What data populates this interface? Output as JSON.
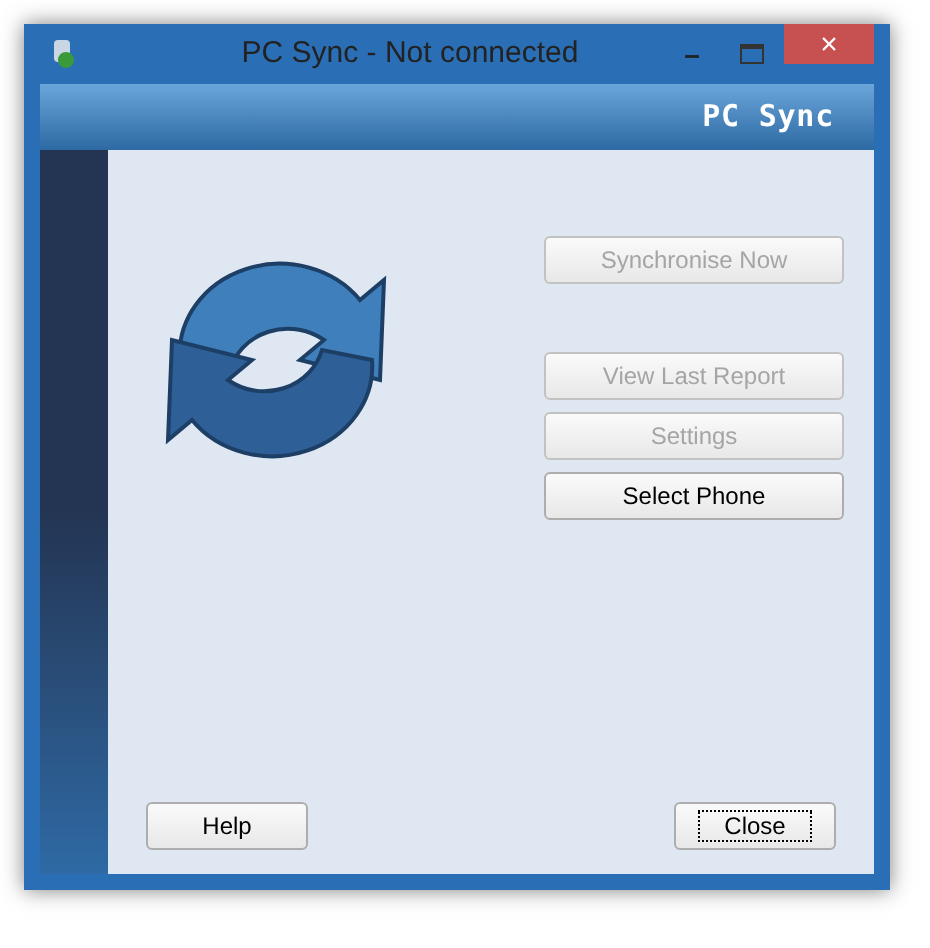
{
  "window": {
    "title": "PC Sync - Not connected",
    "controls": [
      "–",
      "×"
    ]
  },
  "header": {
    "title": "PC Sync"
  },
  "actions": [
    {
      "label": "Synchronise Now",
      "disabled": true
    },
    {
      "label": "View Last Report",
      "disabled": true
    },
    {
      "label": "Settings",
      "disabled": true
    },
    {
      "label": "Select Phone",
      "disabled": false
    }
  ],
  "footer": [
    {
      "label": "Help",
      "focused": false
    },
    {
      "label": "Close",
      "focused": true
    }
  ]
}
